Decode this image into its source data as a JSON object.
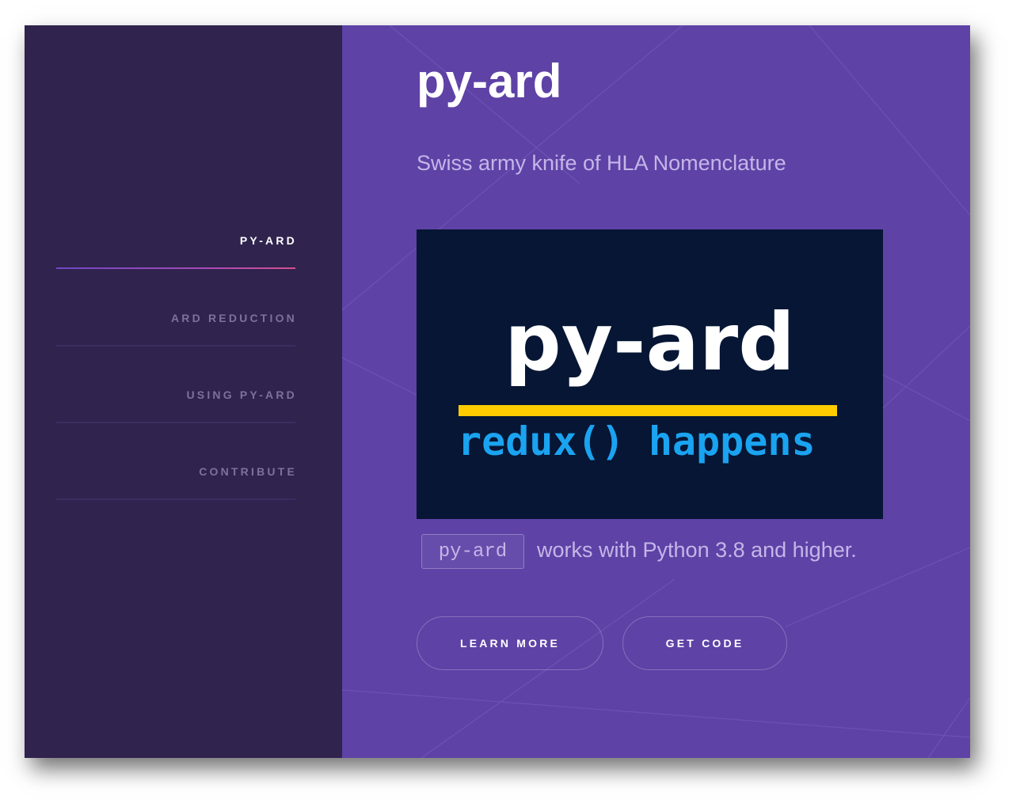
{
  "sidebar": {
    "items": [
      {
        "label": "PY-ARD",
        "active": true
      },
      {
        "label": "ARD REDUCTION",
        "active": false
      },
      {
        "label": "USING PY-ARD",
        "active": false
      },
      {
        "label": "CONTRIBUTE",
        "active": false
      }
    ]
  },
  "main": {
    "title": "py-ard",
    "subtitle": "Swiss army knife of HLA Nomenclature",
    "banner": {
      "title": "py-ard",
      "tagline": "redux() happens"
    },
    "code_badge": "py-ard",
    "compat_text": "works with Python 3.8 and higher.",
    "buttons": {
      "learn_more": "LEARN MORE",
      "get_code": "GET CODE"
    }
  },
  "colors": {
    "sidebar_bg": "#30234e",
    "main_bg": "#5e42a6",
    "banner_bg": "#061634",
    "banner_bar": "#ffcc00",
    "banner_tagline": "#1aa3f0",
    "accent_gradient_start": "#6f47c6",
    "accent_gradient_end": "#d6508f"
  }
}
